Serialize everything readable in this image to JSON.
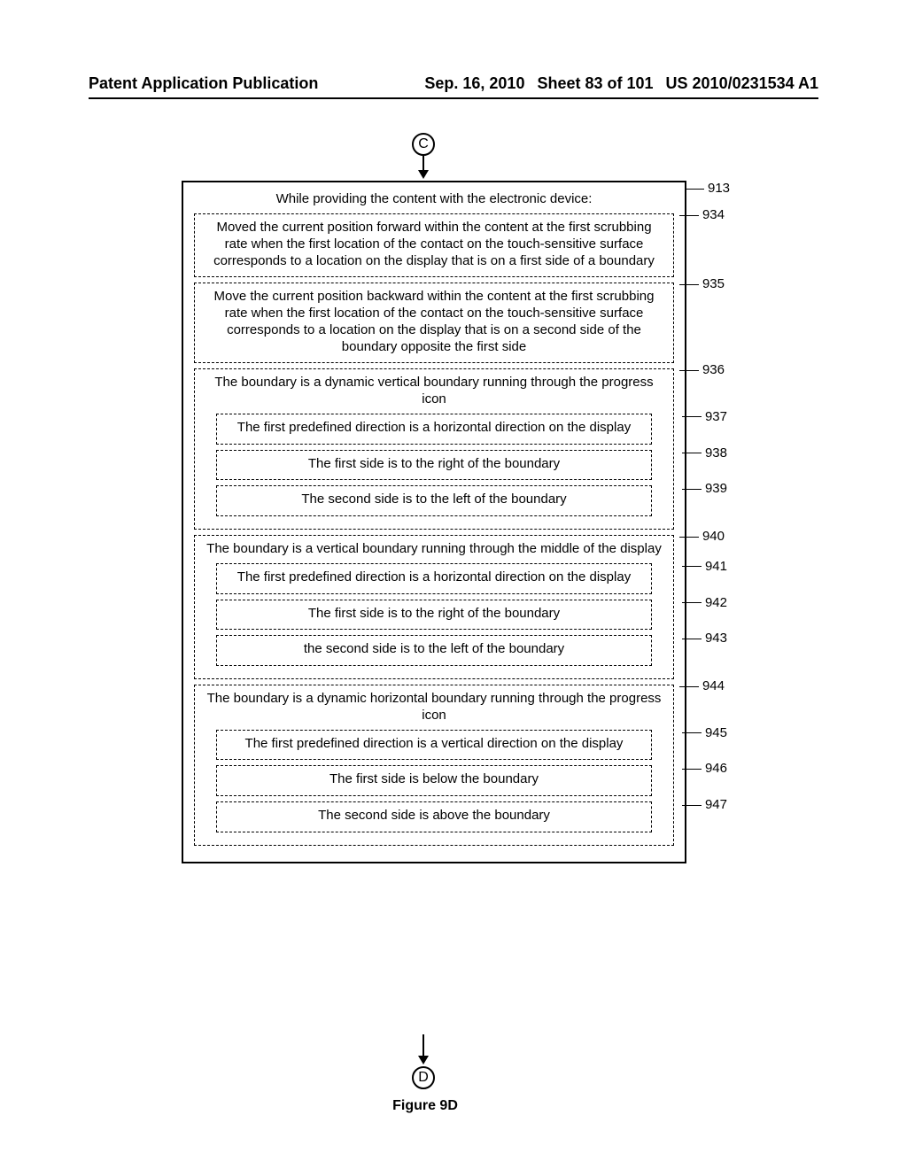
{
  "header": {
    "left": "Patent Application Publication",
    "date": "Sep. 16, 2010",
    "sheet": "Sheet 83 of 101",
    "pubno": "US 2010/0231534 A1"
  },
  "connectors": {
    "top": "C",
    "bottom": "D"
  },
  "outer": {
    "ref": "913",
    "title": "While providing the content with the electronic device:",
    "b934": {
      "ref": "934",
      "text": "Moved the current position forward within the content at the first scrubbing rate when the first location of the contact on the touch-sensitive surface corresponds to a location on the display that is on a first side of a boundary"
    },
    "b935": {
      "ref": "935",
      "text": "Move the current position backward within the content at the first scrubbing rate when the first location of the contact on the touch-sensitive surface corresponds to a location on the display that is on a second side of the boundary opposite the first side"
    },
    "b936": {
      "ref": "936",
      "text": "The boundary is a dynamic  vertical boundary running through the progress icon",
      "b937": {
        "ref": "937",
        "text": "The first predefined direction is a horizontal direction on the display"
      },
      "b938": {
        "ref": "938",
        "text": "The first side is to the right of the boundary"
      },
      "b939": {
        "ref": "939",
        "text": "The second side is to the left of the boundary"
      }
    },
    "b940": {
      "ref": "940",
      "text": "The boundary is a vertical boundary running through the middle of the display",
      "b941": {
        "ref": "941",
        "text": "The first predefined direction is a horizontal direction on the display"
      },
      "b942": {
        "ref": "942",
        "text": "The first side is to the right of the boundary"
      },
      "b943": {
        "ref": "943",
        "text": "the second side is to the left of the boundary"
      }
    },
    "b944": {
      "ref": "944",
      "text": "The boundary is a dynamic horizontal boundary running through the progress icon",
      "b945": {
        "ref": "945",
        "text": "The first predefined direction is a vertical direction on the display"
      },
      "b946": {
        "ref": "946",
        "text": "The first side is below the boundary"
      },
      "b947": {
        "ref": "947",
        "text": "The second side is above the boundary"
      }
    }
  },
  "figure": "Figure 9D"
}
